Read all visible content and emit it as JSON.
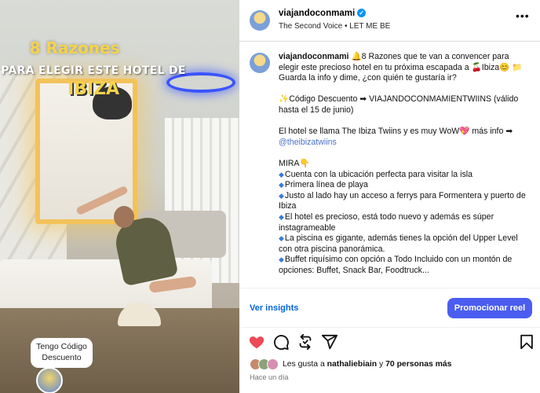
{
  "media": {
    "overlay_line1": "8 Razones",
    "overlay_line2": "PARA ELEGIR ESTE HOTEL DE",
    "overlay_line3": "IBIZA",
    "code_bubble": "Tengo Código Descuento"
  },
  "header": {
    "username": "viajandoconmami",
    "verified": "✓",
    "audio": "The Second Voice • LET ME BE",
    "more": "•••"
  },
  "caption": {
    "username": "viajandoconmami",
    "intro": "🔔8 Razones que te van a convencer para elegir este precioso hotel en tu próxima escapada a 🍒Ibiza😊 📁 Guarda la info y dime, ¿con quién te gustaría ir?",
    "discount": "✨Código Descuento ➡ VIAJANDOCONMAMIENTWIINS (válido hasta el 15 de junio)",
    "hotel_a": "El hotel se llama The Ibiza Twiins y es muy WoW💖 más info ➡",
    "mention": "@theibizatwiins",
    "mira": "MIRA👇",
    "items": [
      "Cuenta con la ubicación perfecta para visitar la isla",
      "Primera línea de playa",
      "Justo al lado hay un acceso a ferrys para Formentera y puerto de Ibiza",
      "El hotel es precioso, está todo nuevo y además es súper instagrameable",
      "La piscina es gigante, además tienes la opción del Upper Level con otra piscina panorámica.",
      "Buffet riquísimo con opción a Todo Incluido con un montón de opciones: Buffet, Snack Bar, Foodtruck..."
    ]
  },
  "actions": {
    "insights": "Ver insights",
    "promote": "Promocionar reel",
    "icons": [
      "heart-icon",
      "comment-icon",
      "repost-icon",
      "share-icon",
      "bookmark-icon"
    ],
    "like_color": "#ed4956"
  },
  "likes": {
    "prefix": "Les gusta a ",
    "user": "nathaliebiain",
    "middle": " y ",
    "others": "70 personas más"
  },
  "time": "Hace un día"
}
